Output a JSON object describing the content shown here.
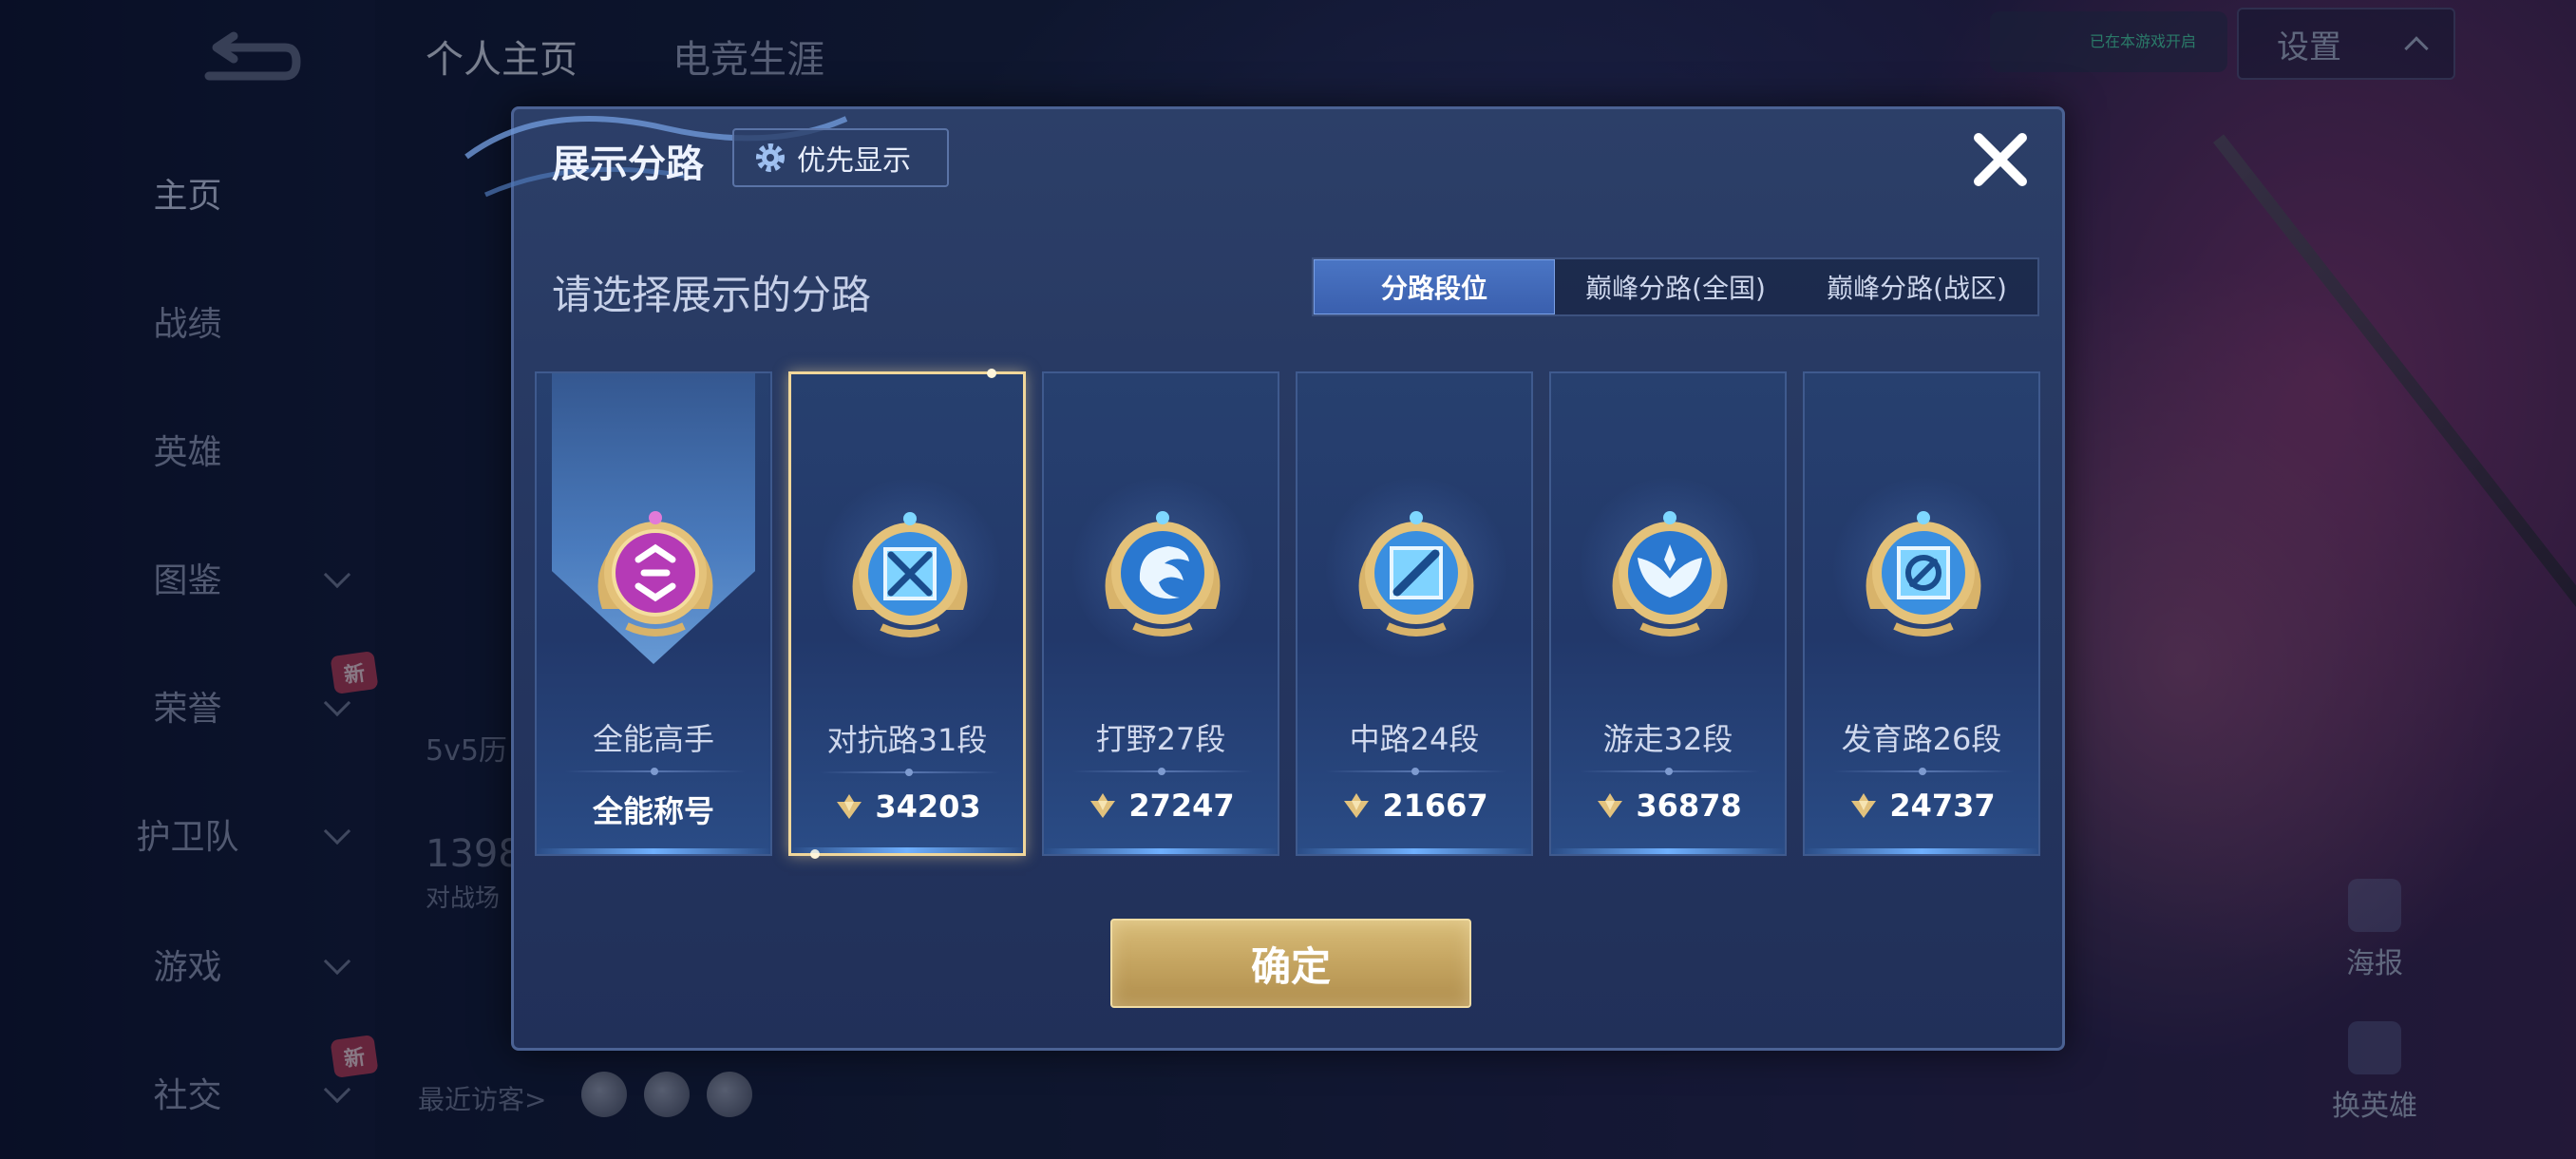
{
  "sidebar": {
    "items": [
      {
        "label": "主页"
      },
      {
        "label": "战绩"
      },
      {
        "label": "英雄"
      },
      {
        "label": "图鉴"
      },
      {
        "label": "荣誉",
        "badge": "新"
      },
      {
        "label": "护卫队"
      },
      {
        "label": "游戏"
      },
      {
        "label": "社交",
        "badge": "新"
      }
    ]
  },
  "profile": {
    "tabs": [
      {
        "label": "个人主页"
      },
      {
        "label": "电竞生涯"
      }
    ],
    "history_label": "5v5历",
    "stat_number": "1398",
    "stat_label": "对战场",
    "recent_visitors": "最近访客>"
  },
  "top_right": {
    "settings_label": "设置",
    "status_text": "已在本游戏开启"
  },
  "right_buttons": [
    {
      "label": "海报"
    },
    {
      "label": "换英雄"
    }
  ],
  "modal": {
    "title": "展示分路",
    "priority_label": "优先显示",
    "subtitle": "请选择展示的分路",
    "segments": [
      {
        "label": "分路段位",
        "active": true
      },
      {
        "label": "巅峰分路(全国)",
        "active": false
      },
      {
        "label": "巅峰分路(战区)",
        "active": false
      }
    ],
    "cards": [
      {
        "name": "全能高手",
        "value": "全能称号",
        "icon": "all-round-emblem",
        "selected": false
      },
      {
        "name": "对抗路31段",
        "value": "34203",
        "icon": "clash-lane-emblem",
        "selected": true
      },
      {
        "name": "打野27段",
        "value": "27247",
        "icon": "jungle-emblem",
        "selected": false
      },
      {
        "name": "中路24段",
        "value": "21667",
        "icon": "mid-lane-emblem",
        "selected": false
      },
      {
        "name": "游走32段",
        "value": "36878",
        "icon": "roam-emblem",
        "selected": false
      },
      {
        "name": "发育路26段",
        "value": "24737",
        "icon": "farm-lane-emblem",
        "selected": false
      }
    ],
    "confirm_label": "确定"
  },
  "colors": {
    "modal_bg": "#253660",
    "accent_gold": "#c4a460",
    "segment_active": "#3a5fae",
    "badge_new": "#b23b58"
  }
}
